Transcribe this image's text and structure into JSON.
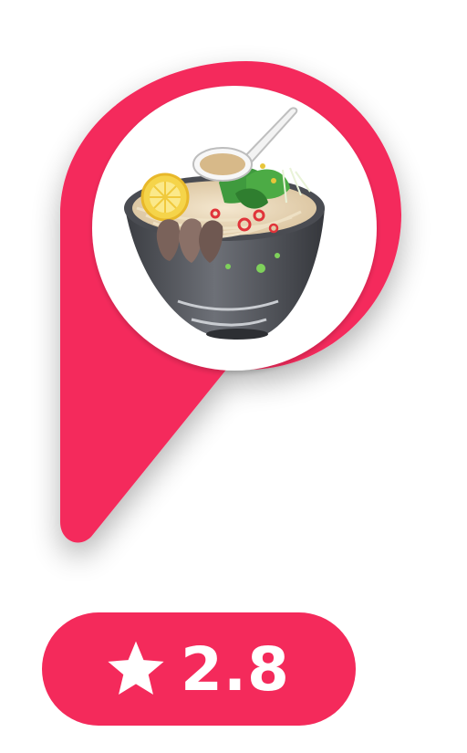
{
  "marker": {
    "icon": "noodle-soup-bowl",
    "accent_color": "#f42a5b"
  },
  "rating": {
    "value": "2.8",
    "icon": "star-icon",
    "background_color": "#f42a5b",
    "text_color": "#ffffff"
  }
}
